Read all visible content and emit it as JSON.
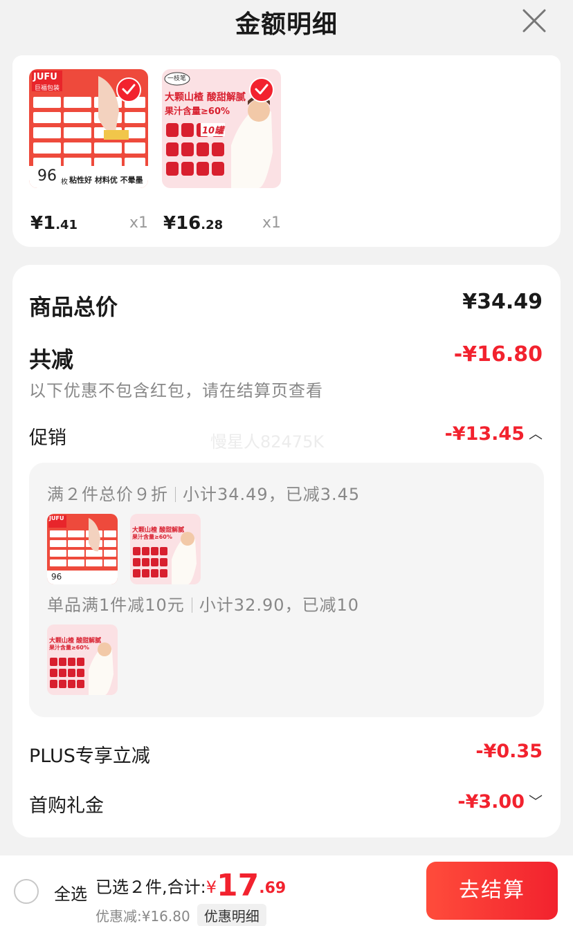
{
  "header": {
    "title": "金额明细"
  },
  "products": [
    {
      "price_int": "¥1",
      "price_dec": ".41",
      "qty": "x1",
      "thumb_badge": "96",
      "thumb_brand": "JUFU",
      "thumb_brand_cn": "巨福包装",
      "thumb_caption": "粘性好 材料优 不晕墨",
      "thumb_unit": "枚"
    },
    {
      "price_int": "¥16",
      "price_dec": ".28",
      "qty": "x1",
      "thumb_line1": "大颗山楂 酸甜解腻",
      "thumb_line2": "果汁含量≥60%",
      "thumb_count": "10罐",
      "thumb_brand": "一枝笔"
    }
  ],
  "summary": {
    "total_label": "商品总价",
    "total_value": "¥34.49",
    "reduce_label": "共减",
    "reduce_value": "-¥16.80",
    "reduce_note": "以下优惠不包含红包，请在结算页查看",
    "promo_label": "促销",
    "promo_value": "-¥13.45",
    "watermark": "慢星人82475K"
  },
  "promo": {
    "line1_a": "满２件总价９折",
    "line1_b": "小计34.49，已减3.45",
    "line2_a": "单品满1件减10元",
    "line2_b": "小计32.90，已减10"
  },
  "plus": {
    "label": "PLUS专享立减",
    "value": "-¥0.35"
  },
  "first": {
    "label": "首购礼金",
    "value": "-¥3.00"
  },
  "bottom": {
    "select_all": "全选",
    "selected_text": "已选２件,合计:",
    "currency": "¥",
    "total_int": "17",
    "total_dec": ".69",
    "discount": "优惠减:¥16.80",
    "detail_button": "优惠明细",
    "checkout_button": "去结算"
  },
  "colors": {
    "accent": "#f2222e",
    "background": "#f2f2f2"
  },
  "icons": {
    "close": "close-icon",
    "check": "check-icon",
    "chevron_up": "chevron-up-icon",
    "chevron_down": "chevron-down-icon",
    "radio": "radio-unchecked-icon"
  }
}
